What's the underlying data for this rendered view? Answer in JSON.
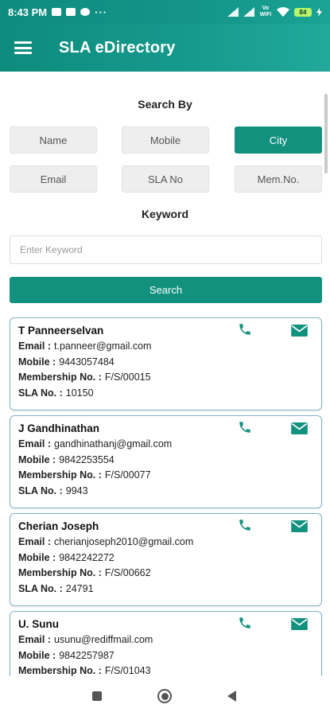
{
  "status_bar": {
    "time": "8:43 PM",
    "overflow": "···",
    "network": "Vo WiFi",
    "battery": "84"
  },
  "app_bar": {
    "title": "SLA eDirectory",
    "menu_icon": "hamburger-menu-icon"
  },
  "search_by": {
    "label": "Search By",
    "options": [
      {
        "label": "Name",
        "selected": false
      },
      {
        "label": "Mobile",
        "selected": false
      },
      {
        "label": "City",
        "selected": true
      },
      {
        "label": "Email",
        "selected": false
      },
      {
        "label": "SLA No",
        "selected": false
      },
      {
        "label": "Mem.No.",
        "selected": false
      }
    ]
  },
  "keyword": {
    "label": "Keyword",
    "placeholder": "Enter Keyword",
    "value": ""
  },
  "search_button": {
    "label": "Search"
  },
  "field_labels": {
    "email": "Email :",
    "mobile": "Mobile :",
    "membership": "Membership No. :",
    "sla": "SLA No. :"
  },
  "members": [
    {
      "name": "T Panneerselvan",
      "email": "t.panneer@gmail.com",
      "mobile": "9443057484",
      "membership_no": "F/S/00015",
      "sla_no": "10150"
    },
    {
      "name": "J Gandhinathan",
      "email": "gandhinathanj@gmail.com",
      "mobile": "9842253554",
      "membership_no": "F/S/00077",
      "sla_no": "9943"
    },
    {
      "name": "Cherian Joseph",
      "email": "cherianjoseph2010@gmail.com",
      "mobile": "9842242272",
      "membership_no": "F/S/00662",
      "sla_no": "24791"
    },
    {
      "name": "U. Sunu",
      "email": "usunu@rediffmail.com",
      "mobile": "9842257987",
      "membership_no": "F/S/01043",
      "sla_no": ""
    }
  ],
  "colors": {
    "primary": "#13917f",
    "card_border": "#7fb3c9",
    "chip_bg": "#eeeeee"
  },
  "icons": {
    "card_call": "phone-icon",
    "card_mail": "mail-icon"
  }
}
